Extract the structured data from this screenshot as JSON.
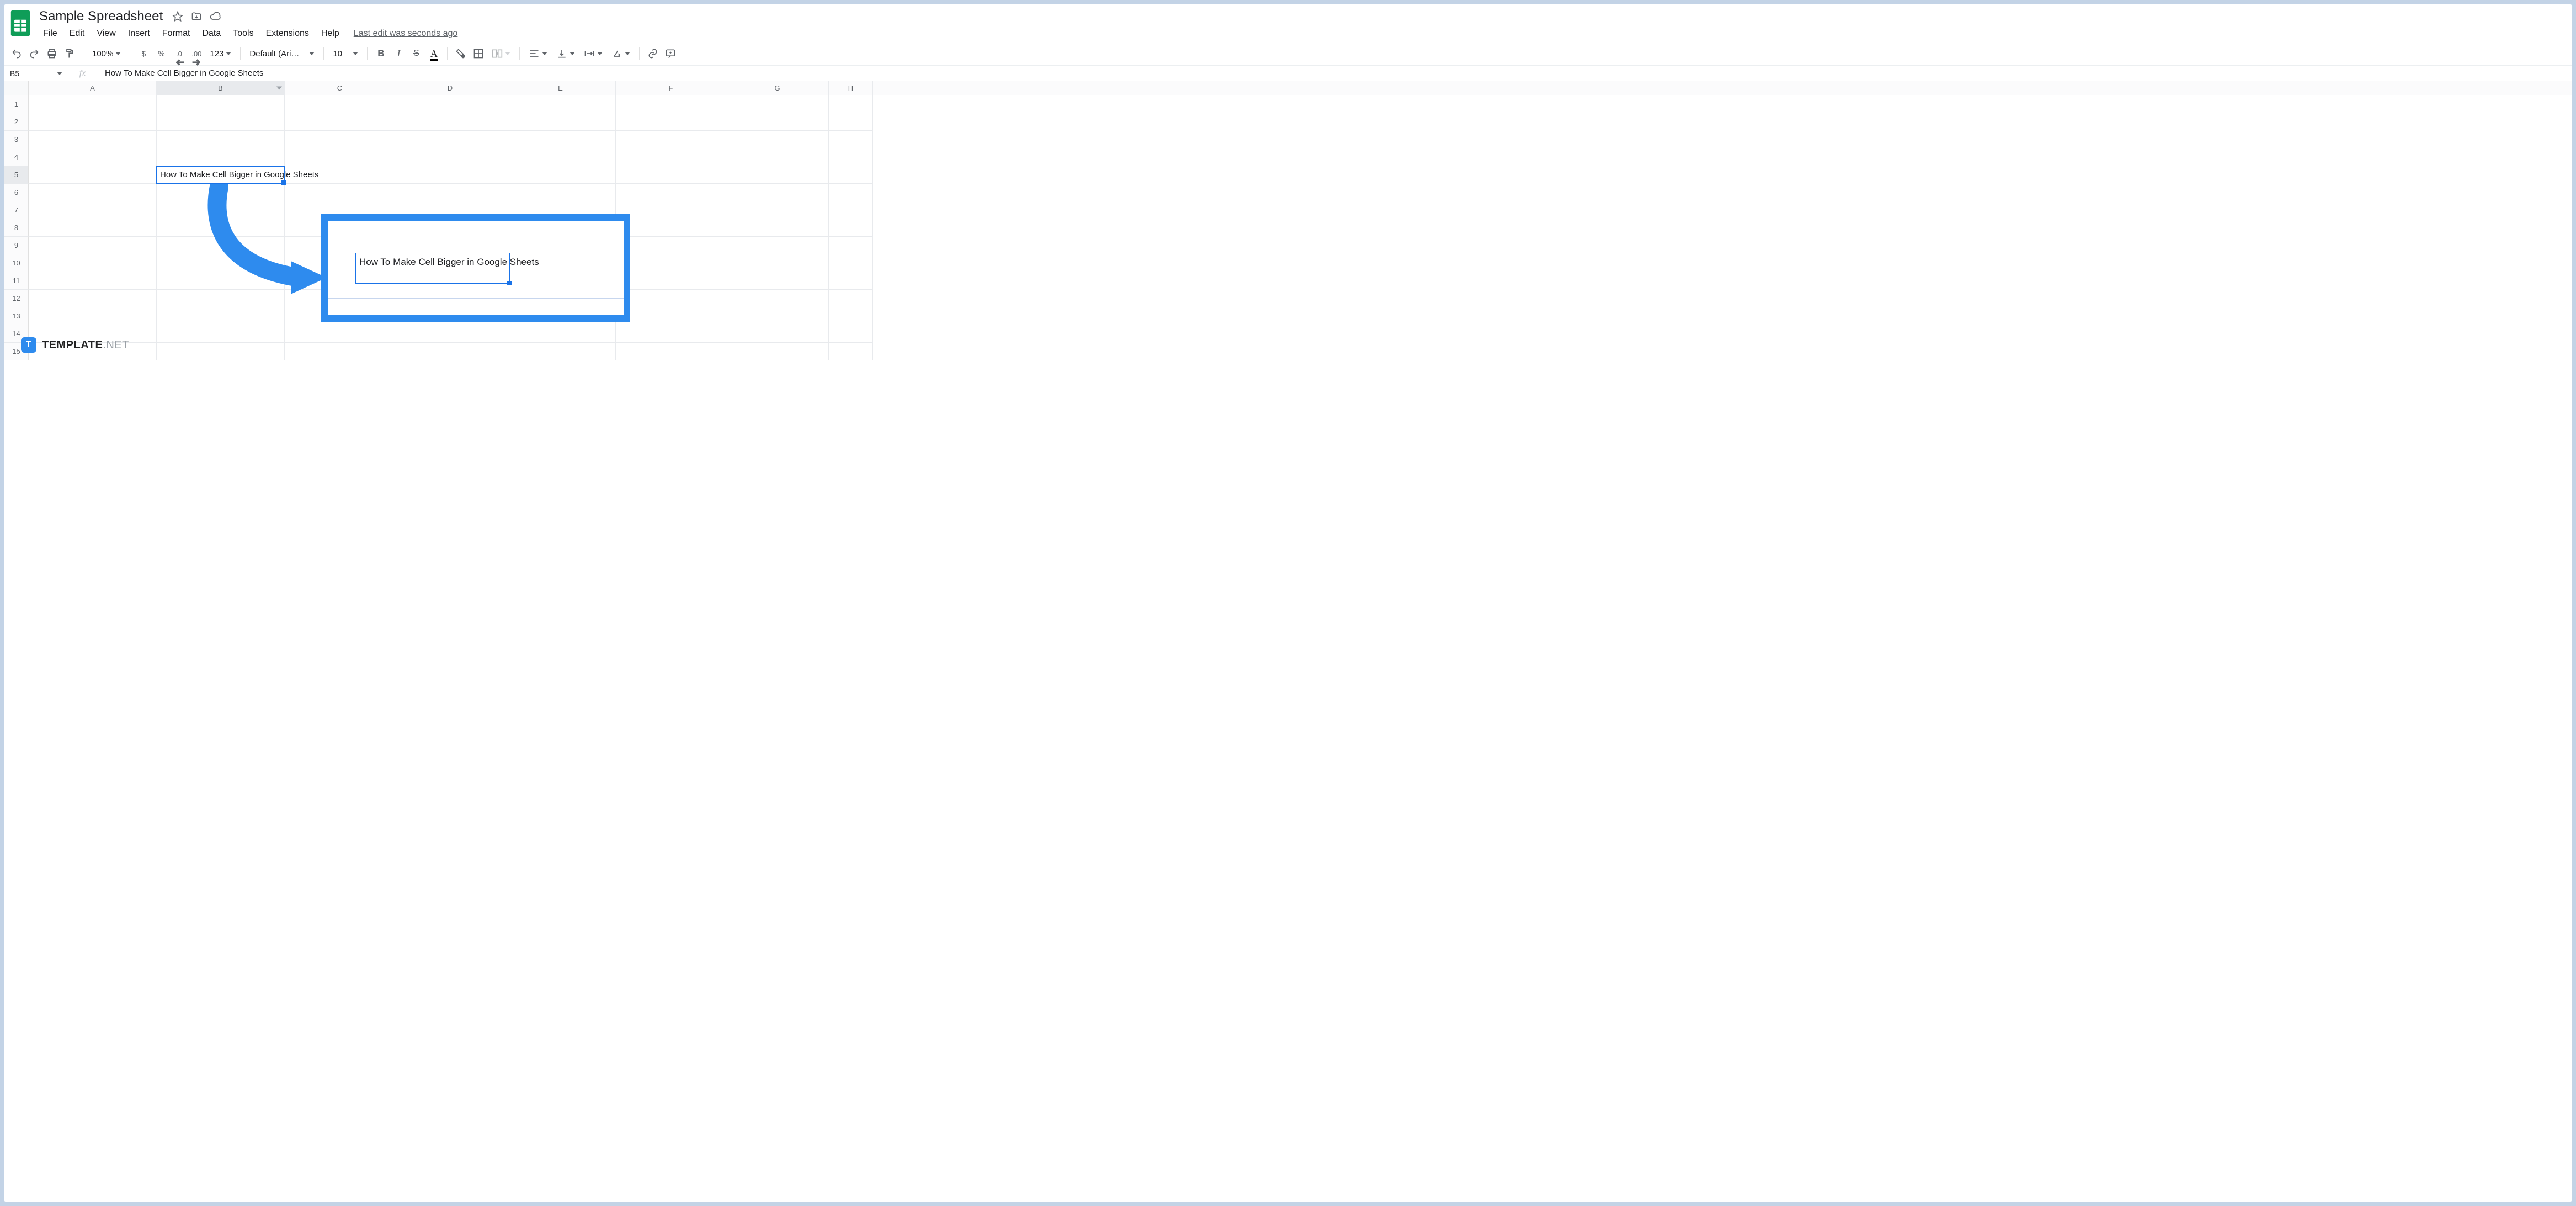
{
  "doc": {
    "title": "Sample Spreadsheet"
  },
  "menu": {
    "items": [
      "File",
      "Edit",
      "View",
      "Insert",
      "Format",
      "Data",
      "Tools",
      "Extensions",
      "Help"
    ],
    "last_edit": "Last edit was seconds ago"
  },
  "toolbar": {
    "zoom": "100%",
    "currency": "$",
    "percent": "%",
    "dec_dec": ".0",
    "dec_inc": ".00",
    "num_fmt": "123",
    "font_name": "Default (Ari…",
    "font_size": "10",
    "text_color_glyph": "A"
  },
  "namebox": {
    "ref": "B5"
  },
  "fx_label": "fx",
  "formula": {
    "value": "How To Make Cell Bigger in Google Sheets"
  },
  "columns": [
    "A",
    "B",
    "C",
    "D",
    "E",
    "F",
    "G",
    "H"
  ],
  "active_column_index": 1,
  "rows": [
    1,
    2,
    3,
    4,
    5,
    6,
    7,
    8,
    9,
    10,
    11,
    12,
    13,
    14,
    15
  ],
  "active_row_index": 4,
  "cell_b5": "How To Make Cell Bigger in Google Sheets",
  "annotation_text": "How To Make Cell Bigger in Google Sheets",
  "watermark": {
    "brand": "TEMPLATE",
    "suffix": ".NET",
    "badge": "T"
  }
}
